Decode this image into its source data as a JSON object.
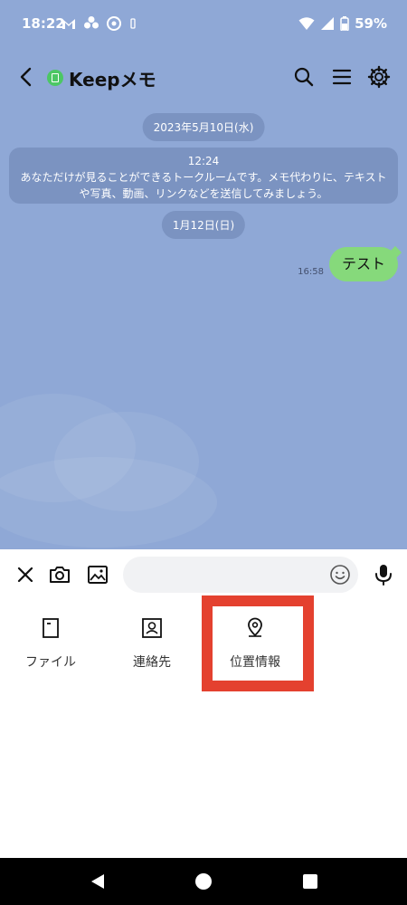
{
  "status": {
    "time": "18:22",
    "battery": "59%"
  },
  "header": {
    "title": "Keepメモ"
  },
  "chat": {
    "dates": [
      "2023年5月10日(水)",
      "1月12日(日)"
    ],
    "system": {
      "time": "12:24",
      "line1": "あなただけが見ることができるトークルームです。メモ代わりに、テキスト",
      "line2": "や写真、動画、リンクなどを送信してみましょう。"
    },
    "message": {
      "text": "テスト",
      "time": "16:58"
    }
  },
  "input": {
    "placeholder": ""
  },
  "attachments": [
    "ファイル",
    "連絡先",
    "位置情報"
  ],
  "colors": {
    "chat_bg": "#8fa8d6",
    "bubble": "#86d97b",
    "highlight": "#e4412f"
  }
}
